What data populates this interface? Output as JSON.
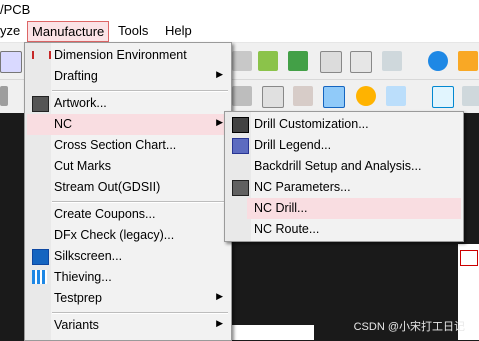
{
  "title_bar": {
    "title": "/PCB"
  },
  "menubar": {
    "items": [
      {
        "label": "yze"
      },
      {
        "label": "Manufacture"
      },
      {
        "label": "Tools"
      },
      {
        "label": "Help"
      }
    ]
  },
  "manufacture_menu": {
    "items": [
      {
        "label": "Dimension Environment",
        "icon": "dimension-icon"
      },
      {
        "label": "Drafting",
        "submenu": true
      },
      {
        "label": "Artwork...",
        "icon": "artwork-icon"
      },
      {
        "label": "NC",
        "submenu": true,
        "highlighted": true
      },
      {
        "label": "Cross Section Chart..."
      },
      {
        "label": "Cut Marks"
      },
      {
        "label": "Stream Out(GDSII)"
      },
      {
        "label": "Create Coupons..."
      },
      {
        "label": "DFx Check (legacy)..."
      },
      {
        "label": "Silkscreen...",
        "icon": "silkscreen-icon"
      },
      {
        "label": "Thieving...",
        "icon": "thieving-icon"
      },
      {
        "label": "Testprep",
        "submenu": true
      },
      {
        "label": "Variants",
        "submenu": true
      }
    ]
  },
  "nc_submenu": {
    "items": [
      {
        "label": "Drill Customization...",
        "icon": "drill-customization-icon"
      },
      {
        "label": "Drill Legend...",
        "icon": "drill-legend-icon"
      },
      {
        "label": "Backdrill Setup and Analysis..."
      },
      {
        "label": "NC Parameters...",
        "icon": "nc-parameters-icon"
      },
      {
        "label": "NC Drill...",
        "highlighted": true
      },
      {
        "label": "NC Route..."
      }
    ]
  },
  "watermark": "CSDN @小宋打工日记"
}
